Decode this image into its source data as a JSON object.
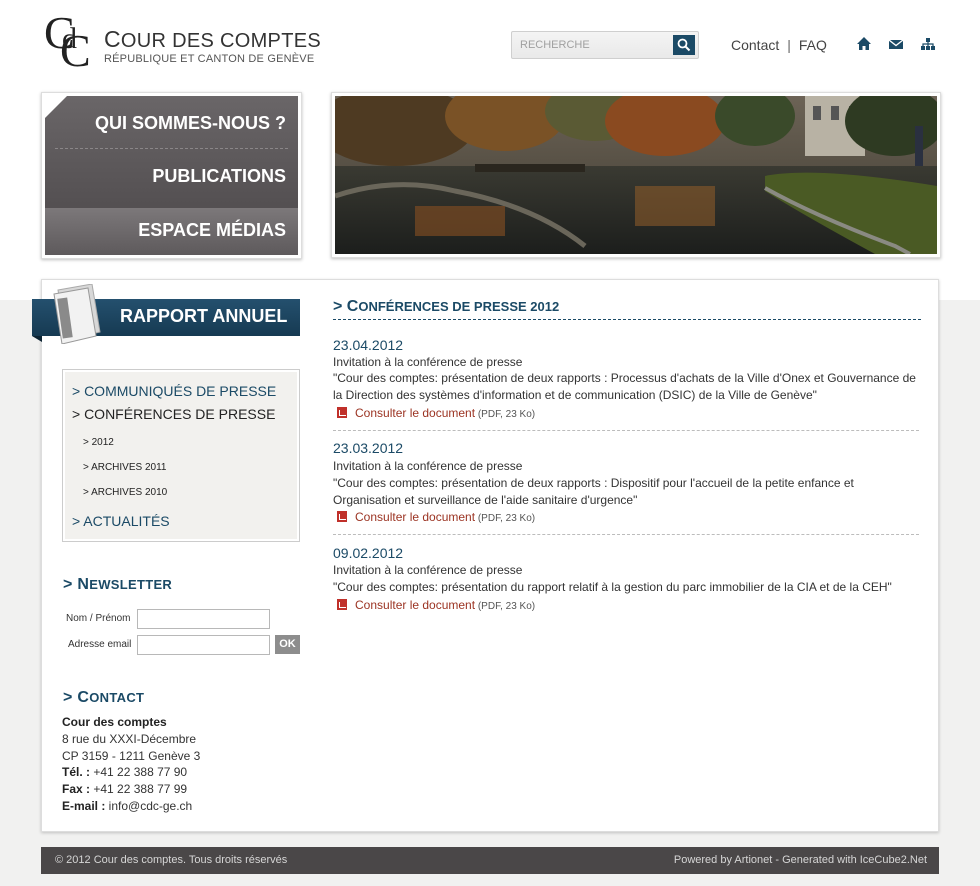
{
  "header": {
    "logo_letters": [
      "C",
      "d",
      "C"
    ],
    "title_initial": "C",
    "title_rest": "OUR DES COMPTES",
    "subtitle": "RÉPUBLIQUE ET CANTON DE GENÈVE",
    "search_placeholder": "RECHERCHE",
    "links": {
      "contact": "Contact",
      "separator": "|",
      "faq": "FAQ"
    },
    "icons": [
      "home-icon",
      "mail-icon",
      "sitemap-icon"
    ],
    "accent_color": "#1b4a66"
  },
  "nav": {
    "items": [
      "QUI SOMMES-NOUS ?",
      "PUBLICATIONS",
      "ESPACE MÉDIAS"
    ]
  },
  "rapport": {
    "label": "RAPPORT ANNUEL"
  },
  "sidemenu": {
    "items": [
      "> COMMUNIQUÉS DE PRESSE",
      "> CONFÉRENCES DE PRESSE"
    ],
    "subitems": [
      "> 2012",
      "> ARCHIVES 2011",
      "> ARCHIVES 2010"
    ],
    "last_item": "> ACTUALITÉS"
  },
  "newsletter": {
    "title_prefix": "> N",
    "title_rest": "EWSLETTER",
    "name_label": "Nom / Prénom",
    "email_label": "Adresse email",
    "ok_label": "OK"
  },
  "contact": {
    "title_prefix": "> C",
    "title_rest": "ONTACT",
    "org": "Cour des comptes",
    "address1": "8 rue du XXXI-Décembre",
    "address2": "CP 3159 - 1211 Genève 3",
    "tel_label": "Tél. :",
    "tel": " +41 22 388 77 90",
    "fax_label": "Fax :",
    "fax": " +41 22 388 77 99",
    "email_label": "E-mail :",
    "email": " info@cdc-ge.ch"
  },
  "content": {
    "title_prefix": "> C",
    "title_rest": "ONFÉRENCES DE PRESSE 2012",
    "entries": [
      {
        "date": "23.04.2012",
        "subtitle": "Invitation à la conférence de presse",
        "text": "\"Cour des comptes: présentation de deux rapports : Processus d'achats de la Ville d'Onex et Gouvernance de la Direction des systèmes d'information et de communication (DSIC) de la Ville de Genève\"",
        "doc_link": "Consulter le document",
        "doc_meta": " (PDF, 23 Ko)"
      },
      {
        "date": "23.03.2012",
        "subtitle": "Invitation à la conférence de presse",
        "text": "\"Cour des comptes: présentation de deux rapports : Dispositif pour l'accueil de la petite enfance et Organisation et surveillance de l'aide sanitaire d'urgence\"",
        "doc_link": "Consulter le document",
        "doc_meta": " (PDF, 23 Ko)"
      },
      {
        "date": "09.02.2012",
        "subtitle": "Invitation à la conférence de presse",
        "text": "\"Cour des comptes: présentation du rapport relatif à la gestion du parc immobilier de la CIA et de la CEH\"",
        "doc_link": "Consulter le document",
        "doc_meta": " (PDF, 23 Ko)"
      }
    ]
  },
  "footer": {
    "left": "© 2012 Cour des comptes. Tous droits réservés",
    "right": "Powered by Artionet - Generated with IceCube2.Net"
  }
}
